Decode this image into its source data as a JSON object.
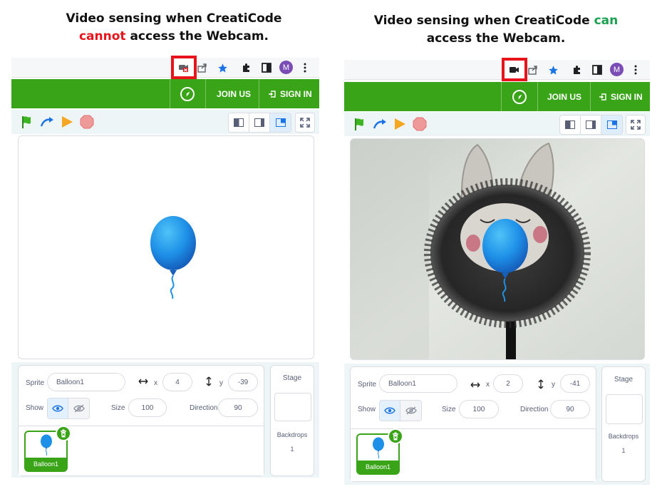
{
  "left": {
    "caption_line1": "Video sensing when CreatiCode",
    "caption_neg": "cannot",
    "caption_rest": " access the Webcam.",
    "camera_icon": "camera-blocked-icon",
    "avatar": "M",
    "join_label": "JOIN US",
    "signin_label": "SIGN IN",
    "sprite_label": "Sprite",
    "sprite_name": "Balloon1",
    "x_label": "x",
    "x_value": "4",
    "y_label": "y",
    "y_value": "-39",
    "show_label": "Show",
    "size_label": "Size",
    "size_value": "100",
    "direction_label": "Direction",
    "direction_value": "90",
    "stage_label": "Stage",
    "backdrops_label": "Backdrops",
    "backdrops_count": "1",
    "card_name": "Balloon1"
  },
  "right": {
    "caption_pre": "Video sensing when CreatiCode ",
    "caption_pos": "can",
    "caption_line2": "access the Webcam.",
    "camera_icon": "camera-icon",
    "avatar": "M",
    "join_label": "JOIN US",
    "signin_label": "SIGN IN",
    "sprite_label": "Sprite",
    "sprite_name": "Balloon1",
    "x_label": "x",
    "x_value": "2",
    "y_label": "y",
    "y_value": "-41",
    "show_label": "Show",
    "size_label": "Size",
    "size_value": "100",
    "direction_label": "Direction",
    "direction_value": "90",
    "stage_label": "Stage",
    "backdrops_label": "Backdrops",
    "backdrops_count": "1",
    "card_name": "Balloon1"
  },
  "colors": {
    "menubar": "#3aa419",
    "warning": "#e8141b",
    "success": "#1aa14f",
    "avatar": "#7b4cb5",
    "balloon": "#1e90e8"
  }
}
